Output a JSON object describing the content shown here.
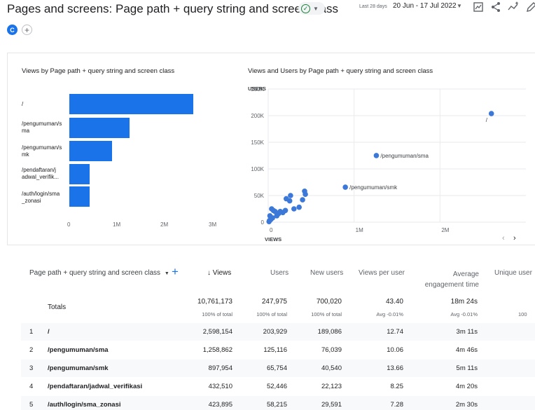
{
  "header": {
    "title": "Pages and screens: Page path + query string and screen class",
    "date_label": "Last 28 days",
    "date_range": "20 Jun - 17 Jul 2022",
    "comparison_chip": "C",
    "icons": [
      "check-circle-icon",
      "customize-report-icon",
      "share-icon",
      "insights-icon",
      "edit-icon"
    ]
  },
  "bar_chart": {
    "title": "Views by Page path + query string and screen class",
    "x_ticks": [
      "0",
      "1M",
      "2M",
      "3M"
    ]
  },
  "scatter_chart": {
    "title": "Views and Users by Page path + query string and screen class",
    "y_axis_label": "USERS",
    "x_axis_label": "VIEWS",
    "y_ticks": [
      "250K",
      "200K",
      "150K",
      "100K",
      "50K",
      "0"
    ],
    "x_ticks": [
      "0",
      "1M",
      "2M"
    ],
    "point_labels": [
      "/",
      "/pengumuman/sma",
      "/pengumuman/smk"
    ]
  },
  "chart_data": [
    {
      "type": "bar",
      "orientation": "horizontal",
      "title": "Views by Page path + query string and screen class",
      "categories": [
        "/",
        "/pengumuman/sma",
        "/pengumuman/smk",
        "/pendaftaran/jadwal_verifik...",
        "/auth/login/sma_zonasi"
      ],
      "values": [
        2598154,
        1258862,
        897954,
        432510,
        423895
      ],
      "xlim": [
        0,
        3000000
      ]
    },
    {
      "type": "scatter",
      "title": "Views and Users by Page path + query string and screen class",
      "xlabel": "VIEWS",
      "ylabel": "USERS",
      "xlim": [
        0,
        3000000
      ],
      "ylim": [
        0,
        250000
      ],
      "points": [
        {
          "x": 2598154,
          "y": 203929,
          "label": "/"
        },
        {
          "x": 1258862,
          "y": 125116,
          "label": "/pengumuman/sma"
        },
        {
          "x": 897954,
          "y": 65754,
          "label": "/pengumuman/smk"
        },
        {
          "x": 432510,
          "y": 52446
        },
        {
          "x": 423895,
          "y": 58215
        },
        {
          "x": 400000,
          "y": 42000
        },
        {
          "x": 360000,
          "y": 28000
        },
        {
          "x": 300000,
          "y": 25000
        },
        {
          "x": 260000,
          "y": 50000
        },
        {
          "x": 250000,
          "y": 40000
        },
        {
          "x": 210000,
          "y": 44000
        },
        {
          "x": 200000,
          "y": 22000
        },
        {
          "x": 170000,
          "y": 18000
        },
        {
          "x": 140000,
          "y": 20000
        },
        {
          "x": 120000,
          "y": 16000
        },
        {
          "x": 100000,
          "y": 12000
        },
        {
          "x": 80000,
          "y": 20000
        },
        {
          "x": 60000,
          "y": 22000
        },
        {
          "x": 50000,
          "y": 8000
        },
        {
          "x": 40000,
          "y": 25000
        },
        {
          "x": 30000,
          "y": 5000
        },
        {
          "x": 20000,
          "y": 12000
        },
        {
          "x": 15000,
          "y": 3000
        },
        {
          "x": 10000,
          "y": 1000
        }
      ]
    }
  ],
  "table": {
    "dimension_header": "Page path + query string and screen class",
    "columns": [
      "Views",
      "Users",
      "New users",
      "Views per user",
      "Average engagement time",
      "Unique user"
    ],
    "sort_indicator": "↓",
    "totals": {
      "label": "Totals",
      "views": "10,761,173",
      "views_sub": "100% of total",
      "users": "247,975",
      "users_sub": "100% of total",
      "new_users": "700,020",
      "new_users_sub": "100% of total",
      "vpu": "43.40",
      "vpu_sub": "Avg -0.01%",
      "aet": "18m 24s",
      "aet_sub": "Avg -0.01%",
      "uniq_sub": "100"
    },
    "rows": [
      {
        "rank": "1",
        "path": "/",
        "views": "2,598,154",
        "users": "203,929",
        "new_users": "189,086",
        "vpu": "12.74",
        "aet": "3m 11s"
      },
      {
        "rank": "2",
        "path": "/pengumuman/sma",
        "views": "1,258,862",
        "users": "125,116",
        "new_users": "76,039",
        "vpu": "10.06",
        "aet": "4m 46s"
      },
      {
        "rank": "3",
        "path": "/pengumuman/smk",
        "views": "897,954",
        "users": "65,754",
        "new_users": "40,540",
        "vpu": "13.66",
        "aet": "5m 11s"
      },
      {
        "rank": "4",
        "path": "/pendaftaran/jadwal_verifikasi",
        "views": "432,510",
        "users": "52,446",
        "new_users": "22,123",
        "vpu": "8.25",
        "aet": "4m 20s"
      },
      {
        "rank": "5",
        "path": "/auth/login/sma_zonasi",
        "views": "423,895",
        "users": "58,215",
        "new_users": "29,591",
        "vpu": "7.28",
        "aet": "2m 30s"
      }
    ]
  },
  "colors": {
    "accent": "#1a73e8",
    "scatter_point": "#3c78d8"
  }
}
